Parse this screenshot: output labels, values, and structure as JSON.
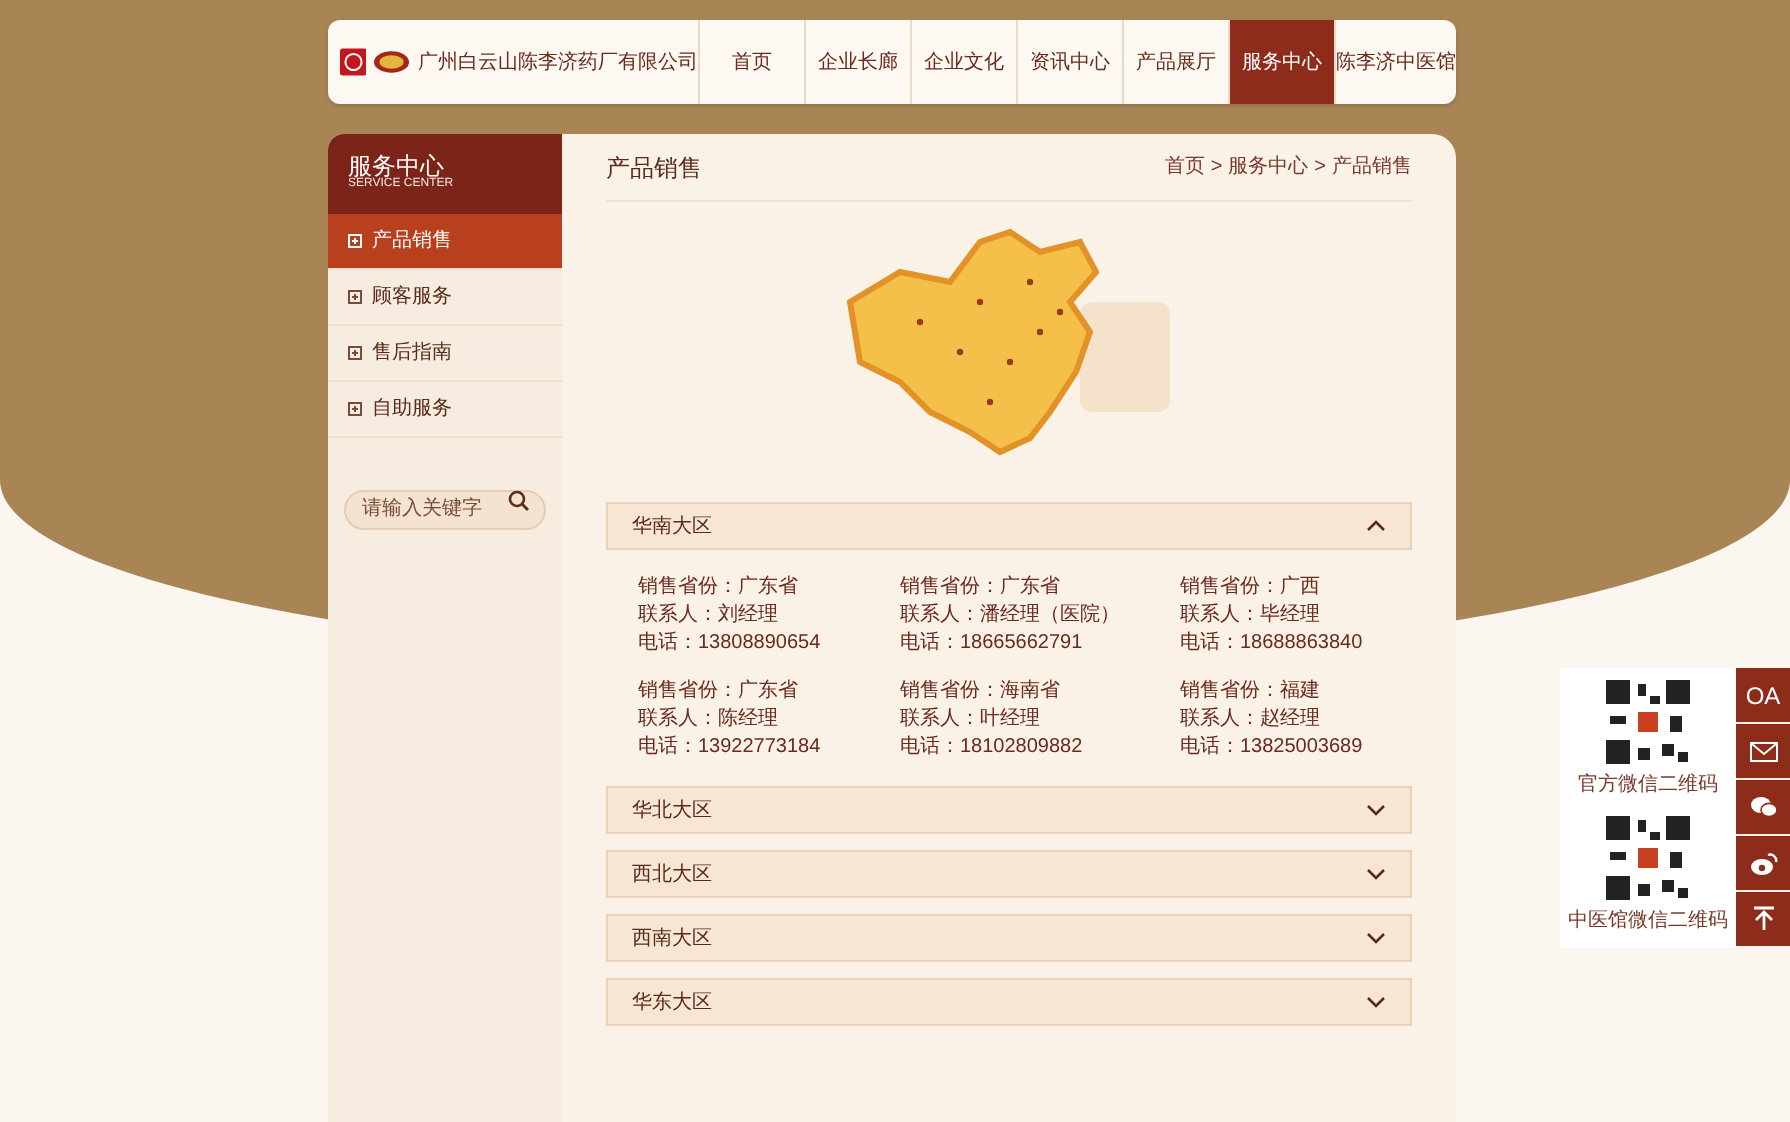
{
  "header": {
    "company": "广州白云山陈李济药厂有限公司",
    "nav": [
      {
        "label": "首页",
        "selected": false
      },
      {
        "label": "企业长廊",
        "selected": false
      },
      {
        "label": "企业文化",
        "selected": false
      },
      {
        "label": "资讯中心",
        "selected": false
      },
      {
        "label": "产品展厅",
        "selected": false
      },
      {
        "label": "服务中心",
        "selected": true
      },
      {
        "label": "陈李济中医馆",
        "selected": false
      }
    ]
  },
  "sidebar": {
    "title": "服务中心",
    "subtitle": "SERVICE CENTER",
    "items": [
      {
        "label": "产品销售",
        "selected": true
      },
      {
        "label": "顾客服务",
        "selected": false
      },
      {
        "label": "售后指南",
        "selected": false
      },
      {
        "label": "自助服务",
        "selected": false
      }
    ],
    "search": {
      "placeholder": "请输入关键字"
    }
  },
  "content": {
    "title": "产品销售",
    "breadcrumb": [
      "首页",
      "服务中心",
      "产品销售"
    ],
    "breadcrumb_separator": ">",
    "regions": [
      {
        "name": "华南大区",
        "expanded": true,
        "contacts": [
          {
            "province": "销售省份：广东省",
            "person": "联系人：刘经理",
            "phone": "电话：13808890654"
          },
          {
            "province": "销售省份：广东省",
            "person": "联系人：潘经理（医院）",
            "phone": "电话：18665662791"
          },
          {
            "province": "销售省份：广西",
            "person": "联系人：毕经理",
            "phone": "电话：18688863840"
          },
          {
            "province": "销售省份：广东省",
            "person": "联系人：陈经理",
            "phone": "电话：13922773184"
          },
          {
            "province": "销售省份：海南省",
            "person": "联系人：叶经理",
            "phone": "电话：18102809882"
          },
          {
            "province": "销售省份：福建",
            "person": "联系人：赵经理",
            "phone": "电话：13825003689"
          }
        ]
      },
      {
        "name": "华北大区",
        "expanded": false
      },
      {
        "name": "西北大区",
        "expanded": false
      },
      {
        "name": "西南大区",
        "expanded": false
      },
      {
        "name": "华东大区",
        "expanded": false
      }
    ]
  },
  "float_bar": {
    "qr_codes": [
      {
        "caption": "官方微信二维码"
      },
      {
        "caption": "中医馆微信二维码"
      }
    ],
    "buttons": [
      {
        "kind": "text",
        "label": "OA"
      },
      {
        "kind": "mail"
      },
      {
        "kind": "wechat"
      },
      {
        "kind": "weibo"
      },
      {
        "kind": "top"
      }
    ]
  }
}
